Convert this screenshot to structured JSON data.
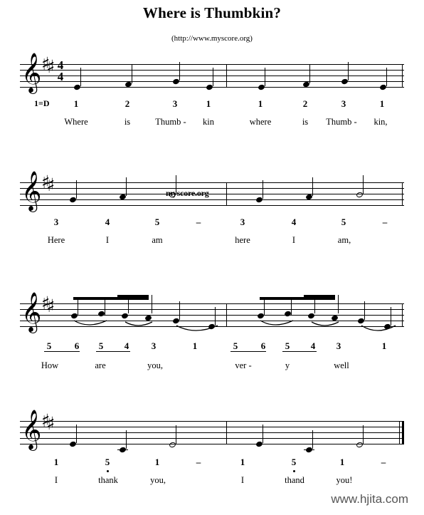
{
  "header": {
    "title": "Where is Thumbkin?",
    "subtitle": "(http://www.myscore.org)"
  },
  "watermark": {
    "text": "myscore.org"
  },
  "footer": {
    "url": "www.hjita.com"
  },
  "score": {
    "key_label": "1=D",
    "clef": "treble-clef",
    "key_signature": "2-sharps",
    "key_signature_glyph": "♯",
    "time_signature_top": "4",
    "time_signature_bottom": "4",
    "clef_glyph": "𝄞"
  },
  "systems": [
    {
      "name": "system-1",
      "numbers": [
        "1",
        "2",
        "3",
        "1",
        "1",
        "2",
        "3",
        "1"
      ],
      "lyrics": [
        "Where",
        "is",
        "Thumb -",
        "kin",
        "where",
        "is",
        "Thumb -",
        "kin,"
      ]
    },
    {
      "name": "system-2",
      "numbers": [
        "3",
        "4",
        "5",
        "–",
        "3",
        "4",
        "5",
        "–"
      ],
      "lyrics": [
        "Here",
        "I",
        "am",
        "",
        "here",
        "I",
        "am,",
        ""
      ]
    },
    {
      "name": "system-3",
      "numbers": [
        "5",
        "6",
        "5",
        "4",
        "3",
        "1",
        "5",
        "6",
        "5",
        "4",
        "3",
        "1"
      ],
      "lyrics": [
        "How",
        "are",
        "you,",
        "ver -",
        "y",
        "well"
      ]
    },
    {
      "name": "system-4",
      "numbers": [
        "1",
        "5",
        "1",
        "–",
        "1",
        "5",
        "1",
        "–"
      ],
      "lyrics": [
        "I",
        "thank",
        "you,",
        "",
        "I",
        "thand",
        "you!"
      ]
    }
  ],
  "chart_data": {
    "type": "table",
    "title": "Where is Thumbkin?",
    "key": "1=D",
    "time_signature": "4/4",
    "measures": [
      {
        "system": 1,
        "numbers": [
          "1",
          "2",
          "3",
          "1"
        ],
        "lyrics": [
          "Where",
          "is",
          "Thumb -",
          "kin"
        ],
        "durations": [
          "quarter",
          "quarter",
          "quarter",
          "quarter"
        ]
      },
      {
        "system": 1,
        "numbers": [
          "1",
          "2",
          "3",
          "1"
        ],
        "lyrics": [
          "where",
          "is",
          "Thumb -",
          "kin,"
        ],
        "durations": [
          "quarter",
          "quarter",
          "quarter",
          "quarter"
        ]
      },
      {
        "system": 2,
        "numbers": [
          "3",
          "4",
          "5",
          "–"
        ],
        "lyrics": [
          "Here",
          "I",
          "am",
          ""
        ],
        "durations": [
          "quarter",
          "quarter",
          "half",
          ""
        ]
      },
      {
        "system": 2,
        "numbers": [
          "3",
          "4",
          "5",
          "–"
        ],
        "lyrics": [
          "here",
          "I",
          "am,",
          ""
        ],
        "durations": [
          "quarter",
          "quarter",
          "half",
          ""
        ]
      },
      {
        "system": 3,
        "numbers": [
          "5",
          "6",
          "5",
          "4",
          "3",
          "1"
        ],
        "lyrics": [
          "How",
          "",
          "are",
          "",
          "you,",
          ""
        ],
        "durations": [
          "eighth",
          "eighth",
          "eighth",
          "eighth",
          "quarter",
          "quarter"
        ]
      },
      {
        "system": 3,
        "numbers": [
          "5",
          "6",
          "5",
          "4",
          "3",
          "1"
        ],
        "lyrics": [
          "ver -",
          "",
          "y",
          "",
          "well",
          ""
        ],
        "durations": [
          "eighth",
          "eighth",
          "eighth",
          "eighth",
          "quarter",
          "quarter"
        ]
      },
      {
        "system": 4,
        "numbers": [
          "1",
          "5",
          "1",
          "–"
        ],
        "lyrics": [
          "I",
          "thank",
          "you,",
          ""
        ],
        "durations": [
          "quarter",
          "quarter",
          "half",
          ""
        ]
      },
      {
        "system": 4,
        "numbers": [
          "1",
          "5",
          "1",
          "–"
        ],
        "lyrics": [
          "I",
          "thand",
          "you!",
          ""
        ],
        "durations": [
          "quarter",
          "quarter",
          "half",
          ""
        ]
      }
    ]
  }
}
